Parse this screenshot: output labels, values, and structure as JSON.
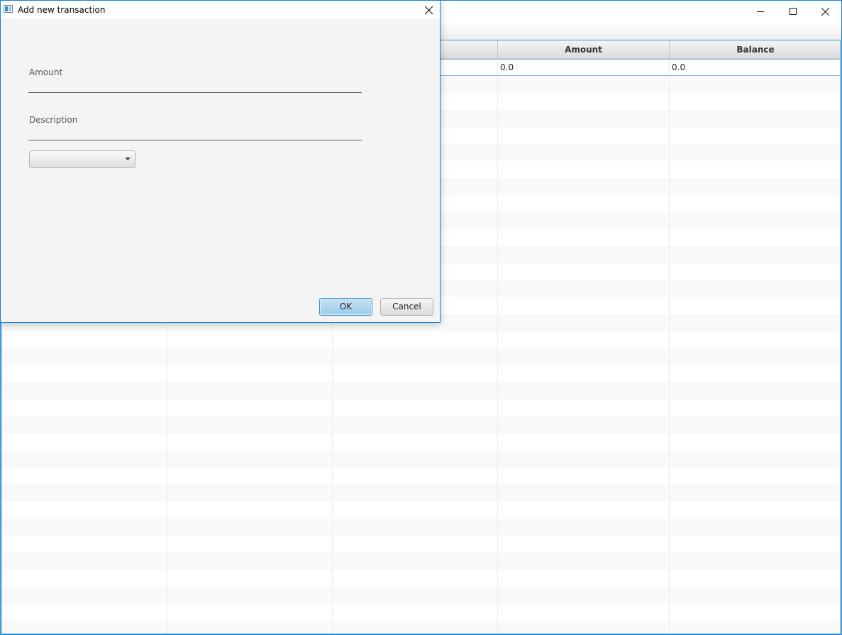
{
  "main_window": {
    "controls": {
      "minimize_icon": "minimize-icon",
      "maximize_icon": "maximize-icon",
      "close_icon": "close-icon"
    },
    "table": {
      "columns": [
        "",
        "",
        "",
        "Amount",
        "Balance"
      ],
      "first_row": [
        "",
        "",
        "",
        "0.0",
        "0.0"
      ]
    }
  },
  "dialog": {
    "title": "Add new transaction",
    "amount_label": "Amount",
    "amount_value": "",
    "description_label": "Description",
    "description_value": "",
    "combo_value": "",
    "ok_label": "OK",
    "cancel_label": "Cancel"
  },
  "colors": {
    "window_border": "#1883d7",
    "ok_button": "#9ccbe9",
    "dialog_background": "#f4f4f4"
  }
}
